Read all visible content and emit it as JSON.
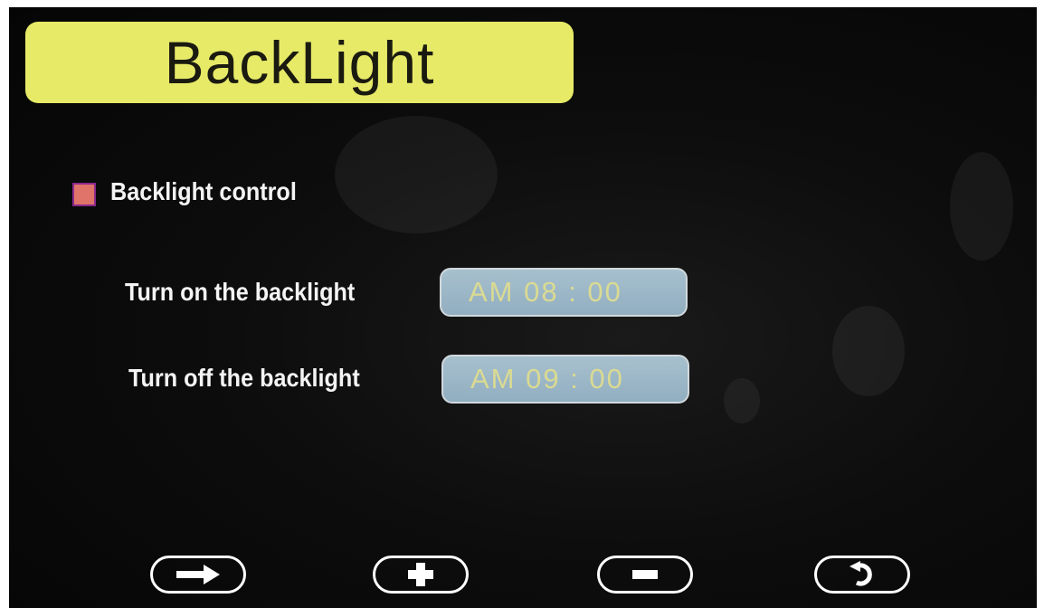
{
  "screen": {
    "title": "BackLight"
  },
  "backlight_control": {
    "label": "Backlight control",
    "checked": true,
    "checkbox_color": "#e0736a"
  },
  "turn_on": {
    "label": "Turn on the backlight",
    "value": "AM 08 : 00"
  },
  "turn_off": {
    "label": "Turn off the backlight",
    "value": "AM 09 : 00"
  },
  "nav_buttons": [
    {
      "name": "next",
      "icon": "arrow-right-icon"
    },
    {
      "name": "increase",
      "icon": "plus-icon"
    },
    {
      "name": "decrease",
      "icon": "minus-icon"
    },
    {
      "name": "back",
      "icon": "return-icon"
    }
  ],
  "colors": {
    "title_bg": "#e7ea67",
    "field_bg": "#a8c7d9",
    "field_text": "#f0f0a0"
  }
}
